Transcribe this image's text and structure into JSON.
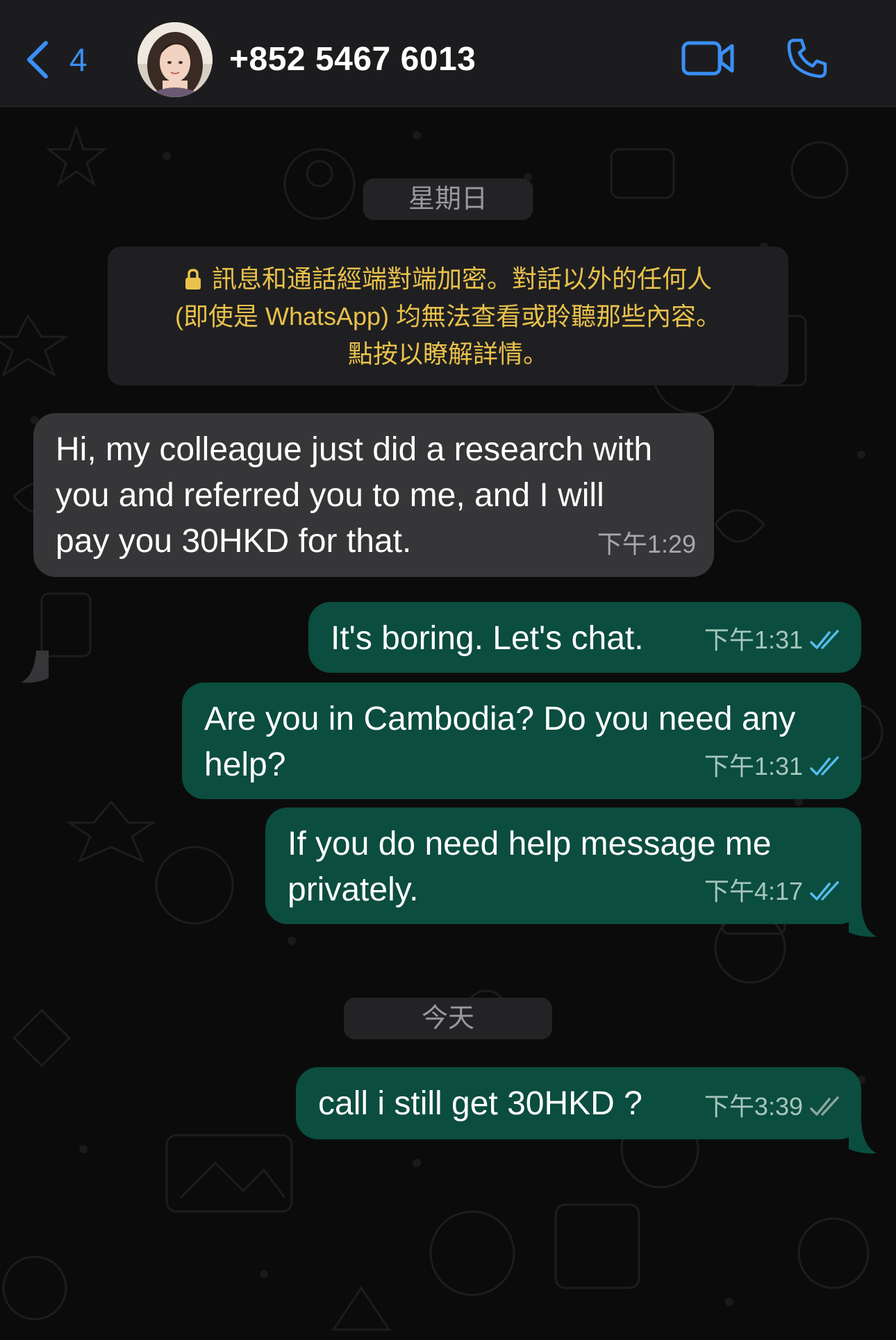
{
  "header": {
    "back_count": "4",
    "contact": "+852 5467 6013"
  },
  "colors": {
    "accent": "#3a8ff6",
    "outgoing_bubble": "#0b4d3e",
    "incoming_bubble": "#363638",
    "encryption_text": "#e9c14b",
    "read_ticks": "#53bdeb"
  },
  "icons": [
    "chevron-left-icon",
    "video-camera-icon",
    "phone-icon",
    "lock-icon",
    "double-check-icon"
  ],
  "chat": {
    "date_sunday": "星期日",
    "encryption": {
      "line1": "訊息和通話經端對端加密。對話以外的任何人",
      "line2": "(即使是 WhatsApp) 均無法查看或聆聽那些內容。",
      "line3": "點按以瞭解詳情。"
    },
    "date_today": "今天",
    "messages": [
      {
        "direction": "in",
        "lines": [
          "Hi, my colleague just did a research with",
          "you and referred you to me, and I will",
          "pay you 30HKD for that."
        ],
        "time": "下午1:29"
      },
      {
        "direction": "out",
        "lines": [
          "It's boring. Let's chat."
        ],
        "time": "下午1:31",
        "status": "read"
      },
      {
        "direction": "out",
        "lines": [
          "Are you in Cambodia? Do you need any",
          "help?"
        ],
        "time": "下午1:31",
        "status": "read"
      },
      {
        "direction": "out",
        "lines": [
          "If you do need help message me",
          "privately."
        ],
        "time": "下午4:17",
        "status": "read"
      },
      {
        "direction": "out",
        "lines": [
          "call i still get 30HKD ?"
        ],
        "time": "下午3:39",
        "status": "delivered"
      }
    ]
  }
}
